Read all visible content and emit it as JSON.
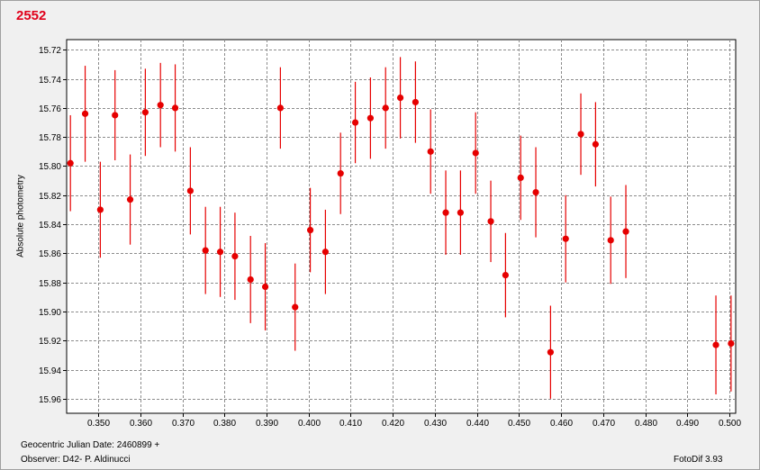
{
  "chart_data": {
    "type": "scatter",
    "title": "2552",
    "xlabel": "",
    "ylabel": "Absolute photometry",
    "xlim": [
      0.3425,
      0.5015
    ],
    "ylim": [
      15.97,
      15.713
    ],
    "y_inverted": true,
    "grid": true,
    "x_ticks": [
      0.35,
      0.36,
      0.37,
      0.38,
      0.39,
      0.4,
      0.41,
      0.42,
      0.43,
      0.44,
      0.45,
      0.46,
      0.47,
      0.48,
      0.49,
      0.5
    ],
    "y_ticks": [
      15.72,
      15.74,
      15.76,
      15.78,
      15.8,
      15.82,
      15.84,
      15.86,
      15.88,
      15.9,
      15.92,
      15.94,
      15.96
    ],
    "x_tick_labels": [
      "0.350",
      "0.360",
      "0.370",
      "0.380",
      "0.390",
      "0.400",
      "0.410",
      "0.420",
      "0.430",
      "0.440",
      "0.450",
      "0.460",
      "0.470",
      "0.480",
      "0.490",
      "0.500"
    ],
    "y_tick_labels": [
      "15.72",
      "15.74",
      "15.76",
      "15.78",
      "15.80",
      "15.82",
      "15.84",
      "15.86",
      "15.88",
      "15.90",
      "15.92",
      "15.94",
      "15.96"
    ],
    "marker_color": "#e60000",
    "error_bar_color": "#e60000",
    "series": [
      {
        "points": [
          {
            "x": 0.3434,
            "y": 15.798,
            "err": 0.033
          },
          {
            "x": 0.3469,
            "y": 15.764,
            "err": 0.033
          },
          {
            "x": 0.3505,
            "y": 15.83,
            "err": 0.033
          },
          {
            "x": 0.354,
            "y": 15.765,
            "err": 0.031
          },
          {
            "x": 0.3576,
            "y": 15.823,
            "err": 0.031
          },
          {
            "x": 0.3612,
            "y": 15.763,
            "err": 0.03
          },
          {
            "x": 0.3648,
            "y": 15.758,
            "err": 0.029
          },
          {
            "x": 0.3683,
            "y": 15.76,
            "err": 0.03
          },
          {
            "x": 0.3719,
            "y": 15.817,
            "err": 0.03
          },
          {
            "x": 0.3755,
            "y": 15.858,
            "err": 0.03
          },
          {
            "x": 0.379,
            "y": 15.859,
            "err": 0.031
          },
          {
            "x": 0.3825,
            "y": 15.862,
            "err": 0.03
          },
          {
            "x": 0.3862,
            "y": 15.878,
            "err": 0.03
          },
          {
            "x": 0.3897,
            "y": 15.883,
            "err": 0.03
          },
          {
            "x": 0.3933,
            "y": 15.76,
            "err": 0.028
          },
          {
            "x": 0.3968,
            "y": 15.897,
            "err": 0.03
          },
          {
            "x": 0.4004,
            "y": 15.844,
            "err": 0.029
          },
          {
            "x": 0.404,
            "y": 15.859,
            "err": 0.029
          },
          {
            "x": 0.4076,
            "y": 15.805,
            "err": 0.028
          },
          {
            "x": 0.4111,
            "y": 15.77,
            "err": 0.028
          },
          {
            "x": 0.4147,
            "y": 15.767,
            "err": 0.028
          },
          {
            "x": 0.4183,
            "y": 15.76,
            "err": 0.028
          },
          {
            "x": 0.4218,
            "y": 15.753,
            "err": 0.028
          },
          {
            "x": 0.4254,
            "y": 15.756,
            "err": 0.028
          },
          {
            "x": 0.429,
            "y": 15.79,
            "err": 0.029
          },
          {
            "x": 0.4326,
            "y": 15.832,
            "err": 0.029
          },
          {
            "x": 0.4361,
            "y": 15.832,
            "err": 0.029
          },
          {
            "x": 0.4397,
            "y": 15.791,
            "err": 0.028
          },
          {
            "x": 0.4433,
            "y": 15.838,
            "err": 0.028
          },
          {
            "x": 0.4468,
            "y": 15.875,
            "err": 0.029
          },
          {
            "x": 0.4504,
            "y": 15.808,
            "err": 0.029
          },
          {
            "x": 0.454,
            "y": 15.818,
            "err": 0.031
          },
          {
            "x": 0.4575,
            "y": 15.928,
            "err": 0.032
          },
          {
            "x": 0.4611,
            "y": 15.85,
            "err": 0.03
          },
          {
            "x": 0.4647,
            "y": 15.778,
            "err": 0.028
          },
          {
            "x": 0.4682,
            "y": 15.785,
            "err": 0.029
          },
          {
            "x": 0.4718,
            "y": 15.851,
            "err": 0.03
          },
          {
            "x": 0.4754,
            "y": 15.845,
            "err": 0.032
          },
          {
            "x": 0.4968,
            "y": 15.923,
            "err": 0.034
          },
          {
            "x": 0.5004,
            "y": 15.922,
            "err": 0.033
          }
        ]
      }
    ]
  },
  "info": {
    "julian_date": "Geocentric Julian Date: 2460899 +",
    "observer": "Observer: D42- P. Aldinucci",
    "software": "FotoDif 3.93"
  }
}
